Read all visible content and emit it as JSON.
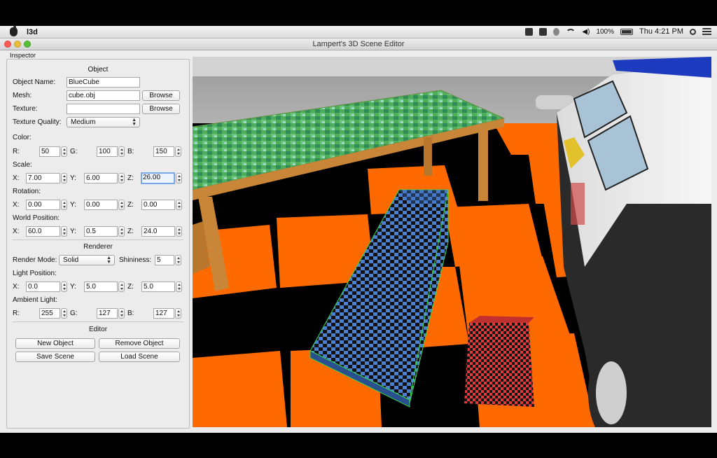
{
  "menubar": {
    "app_name": "l3d",
    "battery": "100%",
    "clock": "Thu 4:21 PM"
  },
  "window": {
    "title": "Lampert's 3D Scene Editor"
  },
  "inspector": {
    "title": "Inspector",
    "object": {
      "heading": "Object",
      "name_label": "Object Name:",
      "name_value": "BlueCube",
      "mesh_label": "Mesh:",
      "mesh_value": "cube.obj",
      "texture_label": "Texture:",
      "texture_value": "",
      "browse_label": "Browse",
      "quality_label": "Texture Quality:",
      "quality_value": "Medium",
      "color_label": "Color:",
      "color_r": "50",
      "color_g": "100",
      "color_b": "150",
      "scale_label": "Scale:",
      "scale_x": "7.00",
      "scale_y": "6.00",
      "scale_z": "26.00",
      "rotation_label": "Rotation:",
      "rot_x": "0.00",
      "rot_y": "0.00",
      "rot_z": "0.00",
      "world_label": "World Position:",
      "pos_x": "60.0",
      "pos_y": "0.5",
      "pos_z": "24.0"
    },
    "renderer": {
      "heading": "Renderer",
      "mode_label": "Render Mode:",
      "mode_value": "Solid",
      "shininess_label": "Shininess:",
      "shininess_value": "5",
      "light_label": "Light Position:",
      "light_x": "0.0",
      "light_y": "5.0",
      "light_z": "5.0",
      "ambient_label": "Ambient Light:",
      "amb_r": "255",
      "amb_g": "127",
      "amb_b": "127"
    },
    "editor": {
      "heading": "Editor",
      "new_object": "New Object",
      "remove_object": "Remove Object",
      "save_scene": "Save Scene",
      "load_scene": "Load Scene"
    },
    "axis": {
      "r": "R:",
      "g": "G:",
      "b": "B:",
      "x": "X:",
      "y": "Y:",
      "z": "Z:"
    }
  },
  "colors": {
    "floor_orange": "#ff6a00",
    "floor_black": "#000000",
    "cube_blue": "#4b7fcf",
    "cube_red": "#e03a3a",
    "table_wood": "#c98638",
    "selection_outline": "#35d84b"
  }
}
